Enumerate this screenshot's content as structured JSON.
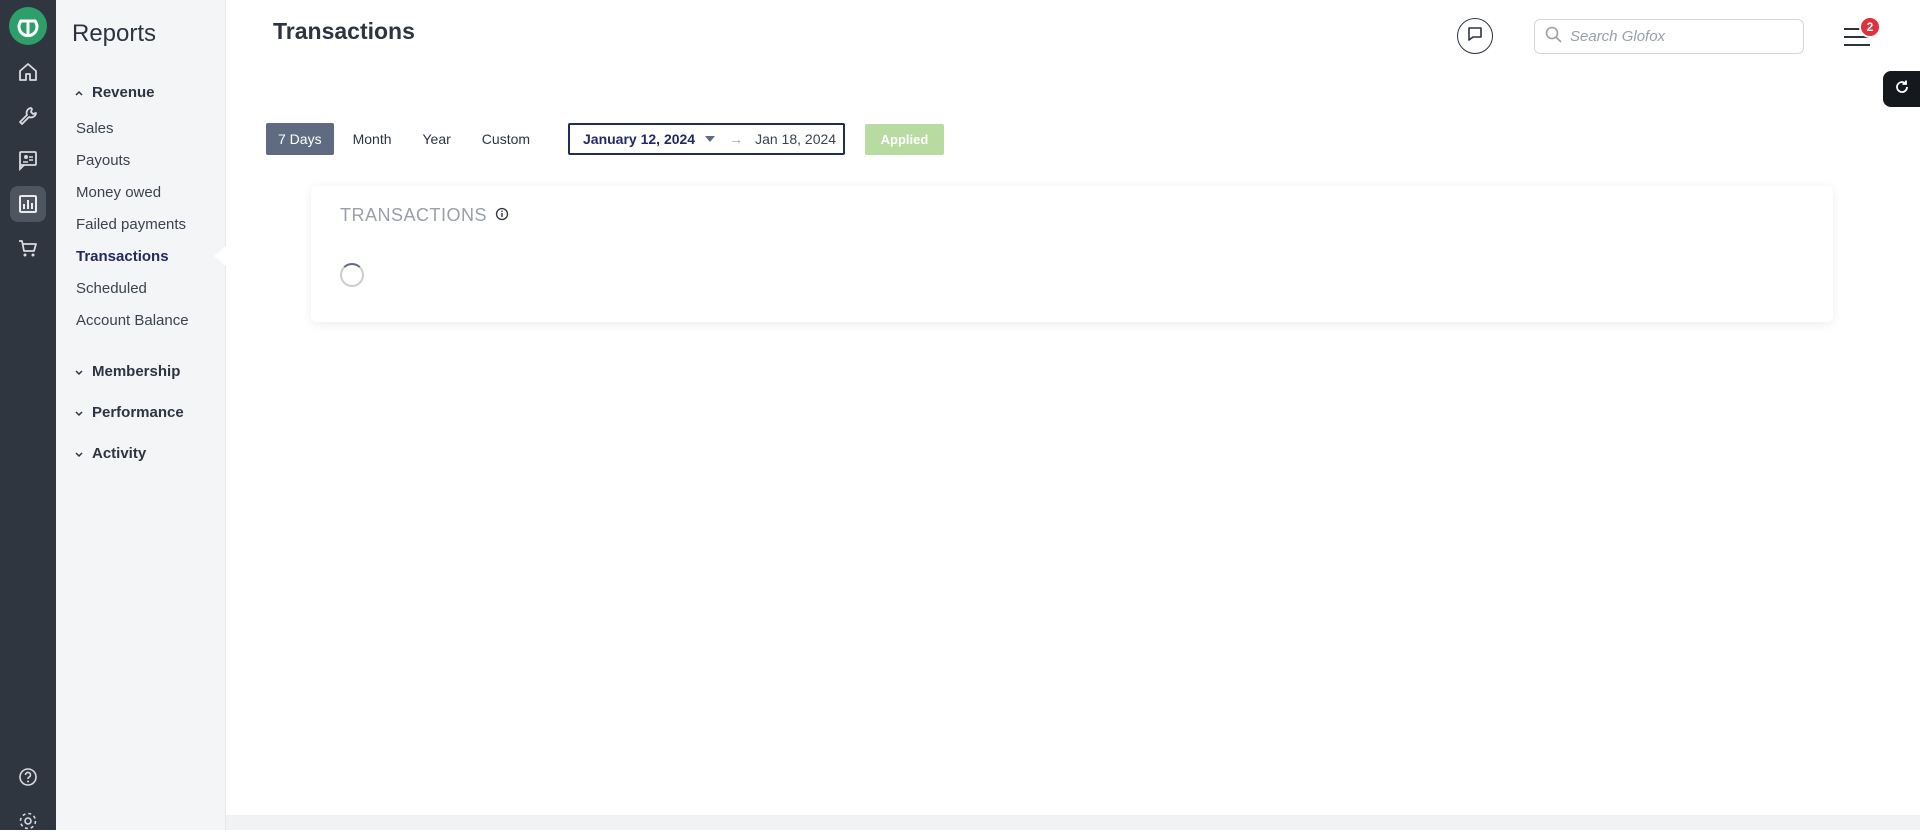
{
  "sidebar": {
    "title": "Reports",
    "groups": [
      {
        "label": "Revenue",
        "expanded": true,
        "items": [
          {
            "label": "Sales"
          },
          {
            "label": "Payouts"
          },
          {
            "label": "Money owed"
          },
          {
            "label": "Failed payments"
          },
          {
            "label": "Transactions",
            "active": true
          },
          {
            "label": "Scheduled"
          },
          {
            "label": "Account Balance"
          }
        ]
      },
      {
        "label": "Membership",
        "expanded": false
      },
      {
        "label": "Performance",
        "expanded": false
      },
      {
        "label": "Activity",
        "expanded": false
      }
    ]
  },
  "rail": {
    "icons": [
      "glofox-logo-icon",
      "home-icon",
      "wrench-icon",
      "member-card-icon",
      "reports-chart-icon",
      "cart-icon",
      "help-icon",
      "settings-gear-icon"
    ],
    "active": "reports-chart-icon"
  },
  "header": {
    "title": "Transactions",
    "search_placeholder": "Search Glofox",
    "notification_count": "2"
  },
  "filters": {
    "periods": [
      "7 Days",
      "Month",
      "Year",
      "Custom"
    ],
    "selected_period": "7 Days",
    "date_start": "January 12, 2024",
    "date_end": "Jan 18, 2024",
    "apply_label": "Applied"
  },
  "card": {
    "title": "TRANSACTIONS",
    "loading": true
  },
  "colors": {
    "rail_bg": "#2f3640",
    "brand_green": "#2e9e6b",
    "active_nav": "#232a5e",
    "period_active": "#5e6b80",
    "applied_bg": "#b7dba1",
    "badge": "#e0303c"
  }
}
